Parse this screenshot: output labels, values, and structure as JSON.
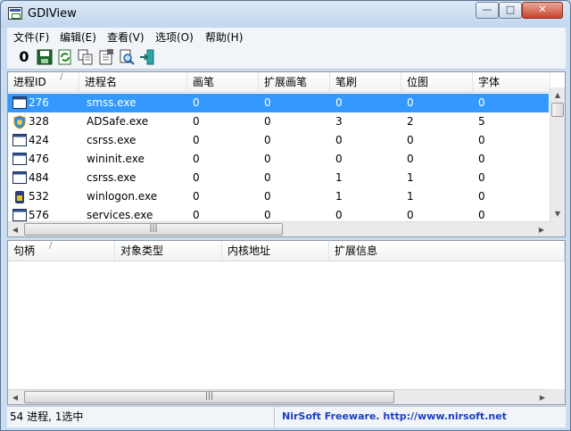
{
  "window": {
    "title": "GDIView",
    "buttons": {
      "minimize": "—",
      "maximize": "□",
      "close": "✕"
    }
  },
  "menu": [
    "文件(F)",
    "编辑(E)",
    "查看(V)",
    "选项(O)",
    "帮助(H)"
  ],
  "toolbar": [
    {
      "name": "zero-icon",
      "glyph": "0"
    },
    {
      "name": "save-icon"
    },
    {
      "name": "refresh-icon"
    },
    {
      "name": "copy-icon"
    },
    {
      "name": "properties-icon"
    },
    {
      "name": "find-icon"
    },
    {
      "name": "exit-icon"
    }
  ],
  "process_table": {
    "columns": [
      "进程ID",
      "进程名",
      "画笔",
      "扩展画笔",
      "笔刷",
      "位图",
      "字体"
    ],
    "rows": [
      {
        "icon": "window-icon",
        "pid": "276",
        "name": "smss.exe",
        "pen": "0",
        "ext_pen": "0",
        "brush": "0",
        "bitmap": "0",
        "font": "0",
        "selected": true
      },
      {
        "icon": "shield-icon",
        "pid": "328",
        "name": "ADSafe.exe",
        "pen": "0",
        "ext_pen": "0",
        "brush": "3",
        "bitmap": "2",
        "font": "5",
        "selected": false
      },
      {
        "icon": "window-icon",
        "pid": "424",
        "name": "csrss.exe",
        "pen": "0",
        "ext_pen": "0",
        "brush": "0",
        "bitmap": "0",
        "font": "0",
        "selected": false
      },
      {
        "icon": "window-icon",
        "pid": "476",
        "name": "wininit.exe",
        "pen": "0",
        "ext_pen": "0",
        "brush": "0",
        "bitmap": "0",
        "font": "0",
        "selected": false
      },
      {
        "icon": "window-icon",
        "pid": "484",
        "name": "csrss.exe",
        "pen": "0",
        "ext_pen": "0",
        "brush": "1",
        "bitmap": "1",
        "font": "0",
        "selected": false
      },
      {
        "icon": "lock-icon",
        "pid": "532",
        "name": "winlogon.exe",
        "pen": "0",
        "ext_pen": "0",
        "brush": "1",
        "bitmap": "1",
        "font": "0",
        "selected": false
      },
      {
        "icon": "window-icon",
        "pid": "576",
        "name": "services.exe",
        "pen": "0",
        "ext_pen": "0",
        "brush": "0",
        "bitmap": "0",
        "font": "0",
        "selected": false
      }
    ]
  },
  "handle_table": {
    "columns": [
      "句柄",
      "对象类型",
      "内核地址",
      "扩展信息"
    ]
  },
  "status": {
    "count": "54 进程, 1选中",
    "credit": "NirSoft Freeware.  http://www.nirsoft.net"
  },
  "colors": {
    "selection": "#3399ff",
    "credit_link": "#1a3ec8"
  }
}
